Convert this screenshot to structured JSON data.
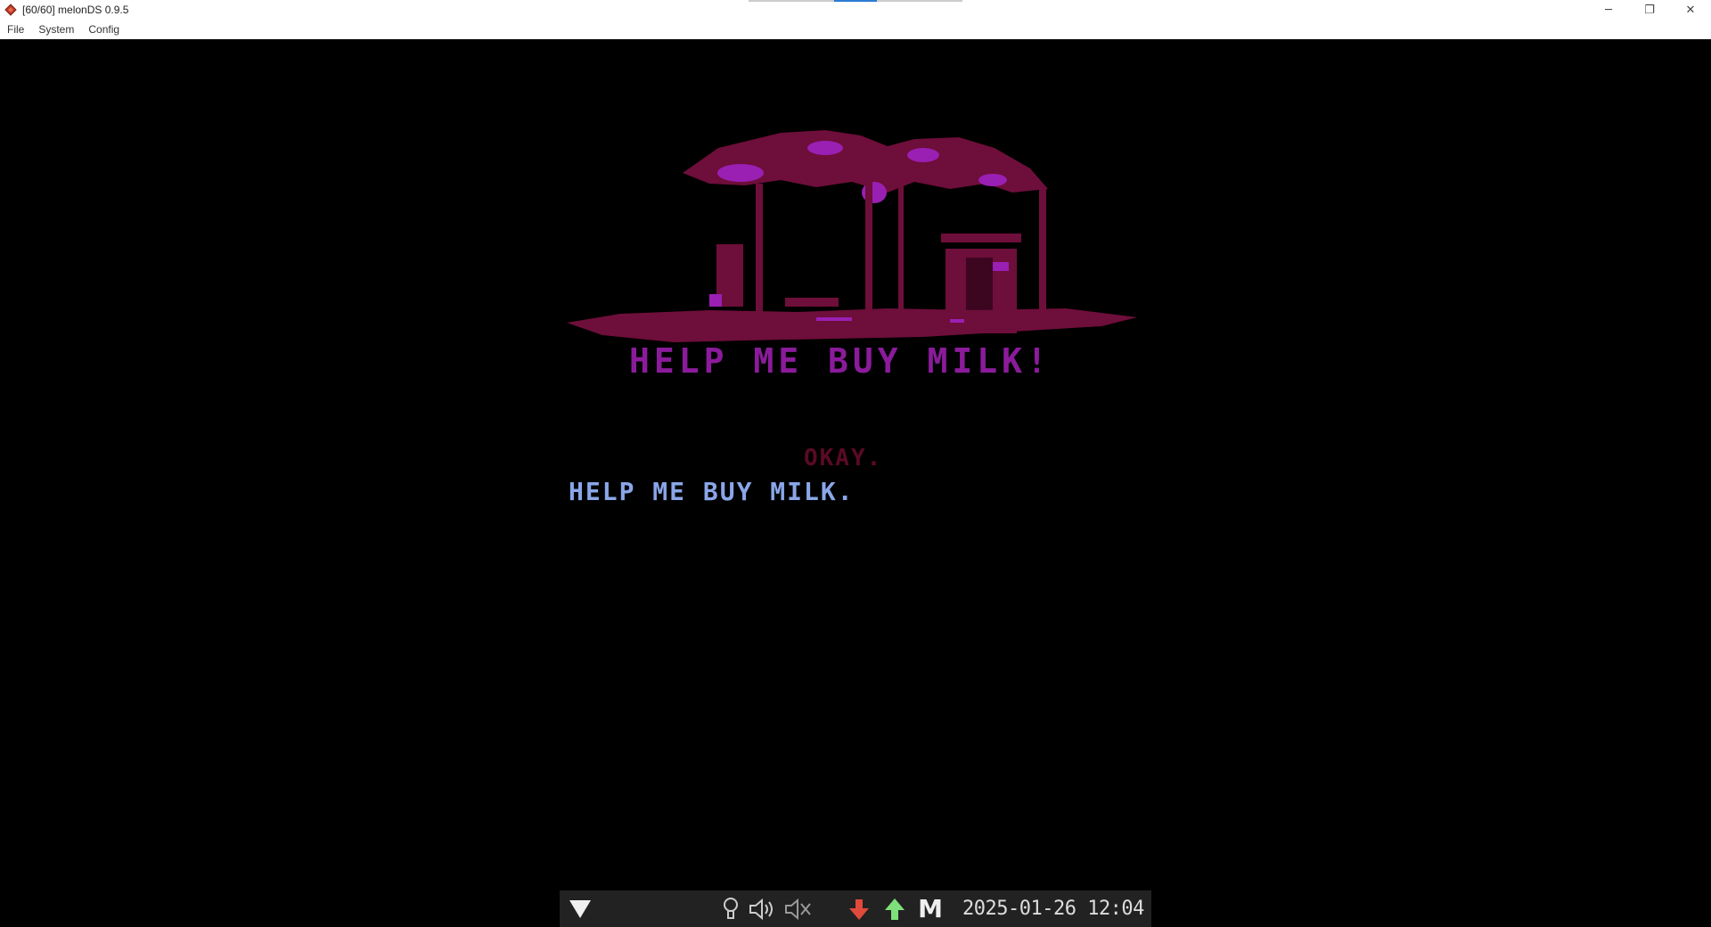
{
  "window": {
    "title": "[60/60] melonDS 0.9.5",
    "controls": {
      "minimize": "─",
      "restore": "❐",
      "close": "✕"
    }
  },
  "menu": {
    "items": [
      "File",
      "System",
      "Config"
    ]
  },
  "game": {
    "headline": "HELP ME BUY MILK!",
    "reply": "OKAY.",
    "player_line": "HELP ME BUY MILK.",
    "colors": {
      "headline": "#8b1b9b",
      "reply": "#5a0a26",
      "player_line": "#8aa6e8",
      "art_primary": "#6e0e3a",
      "art_accent": "#9a1fb3"
    }
  },
  "statusbar": {
    "icons": [
      "menu-triangle-icon",
      "lightbulb-icon",
      "speaker-icon",
      "mute-speaker-icon",
      "download-arrow-icon",
      "upload-arrow-icon",
      "m-icon"
    ],
    "m_label": "M",
    "datetime": "2025-01-26 12:04",
    "colors": {
      "down_arrow": "#e04a3a",
      "up_arrow": "#7ee07a"
    }
  }
}
